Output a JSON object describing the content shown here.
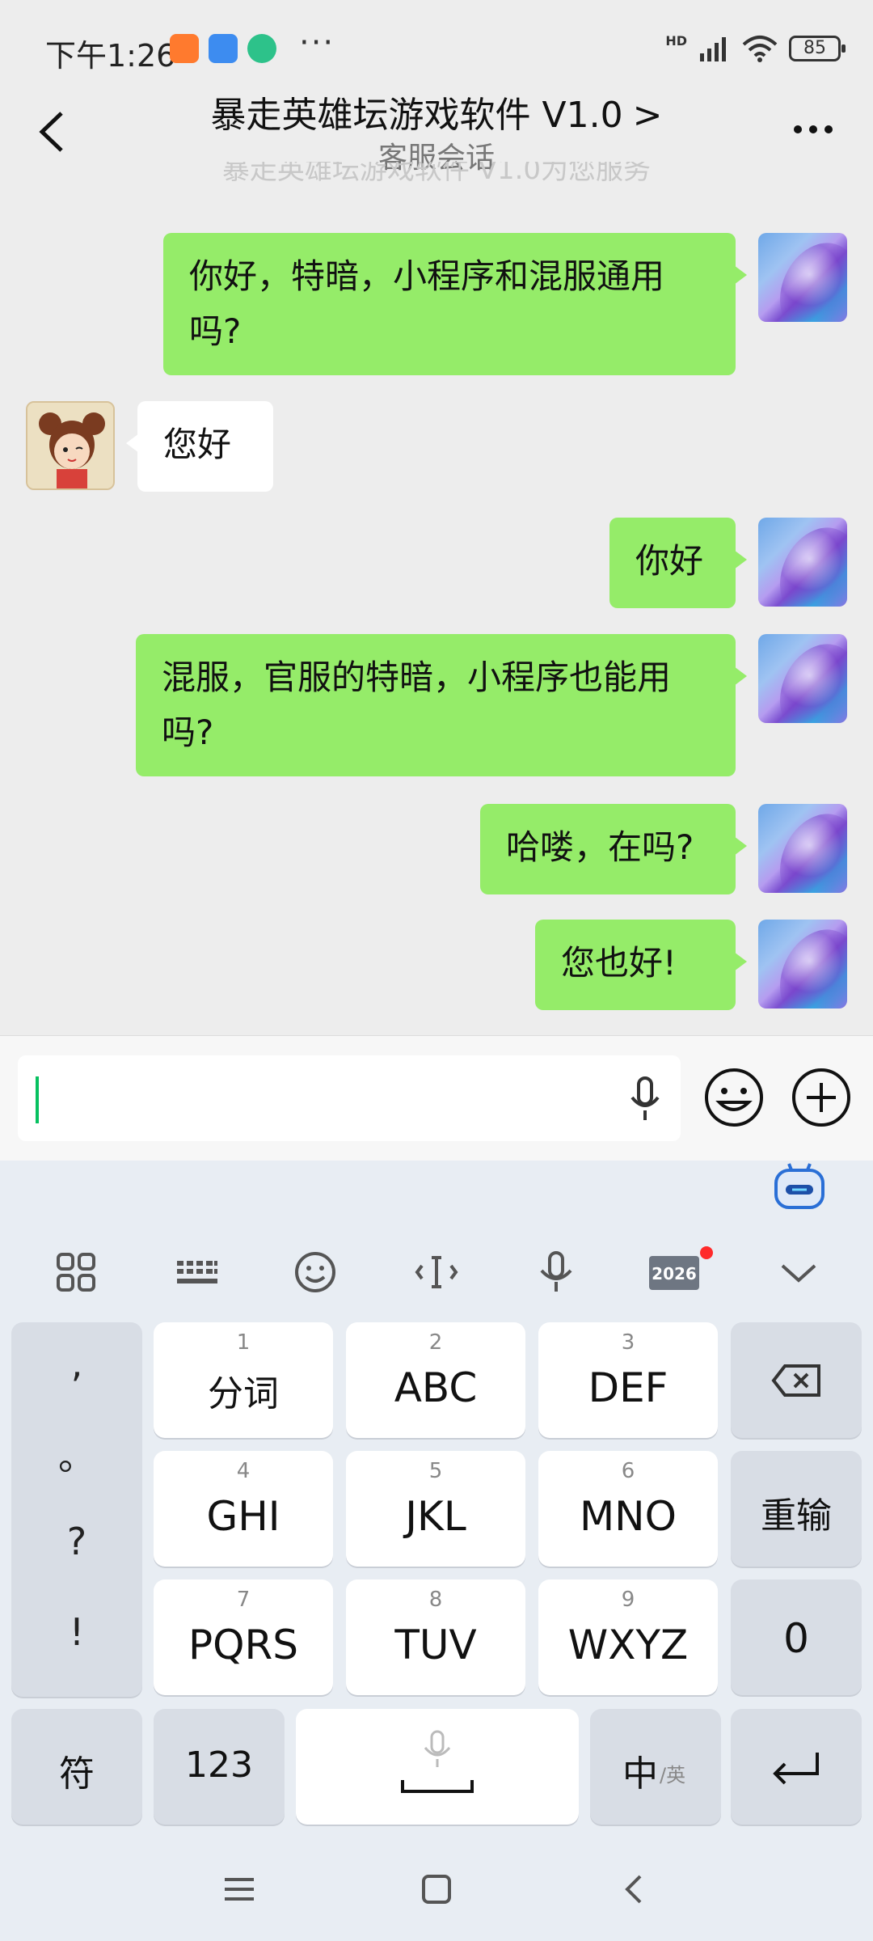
{
  "status_bar": {
    "time": "下午1:26",
    "network": "HD",
    "battery": "85",
    "more": "···"
  },
  "header": {
    "title": "暴走英雄坛游戏软件 V1.0",
    "title_chevron": ">",
    "subtitle": "客服会话"
  },
  "faded_notice": "暴走英雄坛游戏软件 V1.0为您服务",
  "messages": [
    {
      "from": "me",
      "text": "你好，特暗，小程序和混服通用吗?"
    },
    {
      "from": "them",
      "text": "您好"
    },
    {
      "from": "me",
      "text": "你好"
    },
    {
      "from": "me",
      "text": "混服，官服的特暗，小程序也能用吗?"
    },
    {
      "from": "me",
      "text": "哈喽，在吗?"
    },
    {
      "from": "me",
      "text": "您也好!"
    }
  ],
  "input": {
    "value": "",
    "placeholder": ""
  },
  "keyboard": {
    "toolbar_date": "2026",
    "punct": [
      ",",
      "。",
      "?",
      "!"
    ],
    "keys": [
      {
        "num": "1",
        "label": "分词"
      },
      {
        "num": "2",
        "label": "ABC"
      },
      {
        "num": "3",
        "label": "DEF"
      },
      {
        "num": "4",
        "label": "GHI"
      },
      {
        "num": "5",
        "label": "JKL"
      },
      {
        "num": "6",
        "label": "MNO"
      },
      {
        "num": "7",
        "label": "PQRS"
      },
      {
        "num": "8",
        "label": "TUV"
      },
      {
        "num": "9",
        "label": "WXYZ"
      }
    ],
    "reinput": "重输",
    "zero": "0",
    "symbols": "符",
    "numbers": "123",
    "lang_main": "中",
    "lang_alt": "/英"
  }
}
